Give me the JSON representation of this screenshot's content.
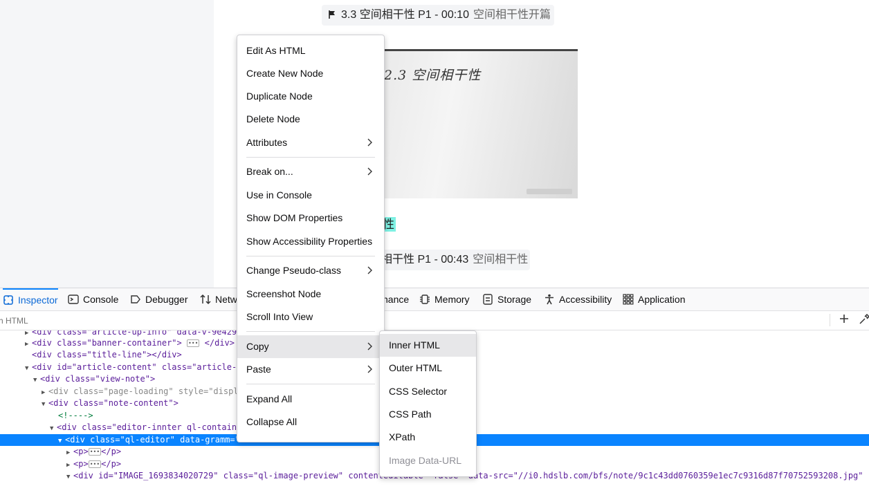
{
  "page": {
    "chip1": {
      "text": "3.3 空间相干性 P1 - 00:10",
      "muted": "空间相干性开篇"
    },
    "image_handwriting": "2.3 空间相干性",
    "highlight_text": "性",
    "chip2": {
      "text": "相干性 P1 - 00:43",
      "muted": "空间相干性"
    }
  },
  "devtools": {
    "tabs": [
      {
        "label": "Inspector",
        "icon": "inspector-icon"
      },
      {
        "label": "Console",
        "icon": "console-icon"
      },
      {
        "label": "Debugger",
        "icon": "debugger-icon"
      },
      {
        "label": "Netw",
        "icon": "network-icon"
      },
      {
        "label": "nance",
        "icon": ""
      },
      {
        "label": "Memory",
        "icon": "memory-icon"
      },
      {
        "label": "Storage",
        "icon": "storage-icon"
      },
      {
        "label": "Accessibility",
        "icon": "accessibility-icon"
      },
      {
        "label": "Application",
        "icon": "application-icon"
      }
    ],
    "search_placeholder": "rch HTML",
    "markup_rows": [
      "<div class=\"article-up-info\" data-v-9e4295",
      "<div class=\"banner-container\">",
      "<div class=\"title-line\"></div>",
      "<div id=\"article-content\" class=\"article-c",
      "<div class=\"view-note\">",
      "<div class=\"page-loading\" style=\"displ",
      "<div class=\"note-content\">",
      "<!---->",
      "<div class=\"editor-innter ql-contain",
      "<div class=\"ql-editor\" data-gramm=\"false\" contenteditable=\"false",
      "<p>",
      "<p>",
      "<div id=\"IMAGE_1693834020729\" class=\"ql-image-preview\" contenteditable=\"false\" data-src=\"//i0.hdslb.com/bfs/note/9c1c43dd0760359e1ec7c9316d87f70752593208.jpg\""
    ]
  },
  "context_menu": {
    "items": [
      "Edit As HTML",
      "Create New Node",
      "Duplicate Node",
      "Delete Node",
      "Attributes",
      "Break on...",
      "Use in Console",
      "Show DOM Properties",
      "Show Accessibility Properties",
      "Change Pseudo-class",
      "Screenshot Node",
      "Scroll Into View",
      "Copy",
      "Paste",
      "Expand All",
      "Collapse All"
    ]
  },
  "copy_submenu": {
    "items": [
      "Inner HTML",
      "Outer HTML",
      "CSS Selector",
      "CSS Path",
      "XPath",
      "Image Data-URL"
    ]
  },
  "colors": {
    "accent": "#0a84ff",
    "highlight": "#7ef1e3",
    "selected_row": "#0a84ff"
  }
}
